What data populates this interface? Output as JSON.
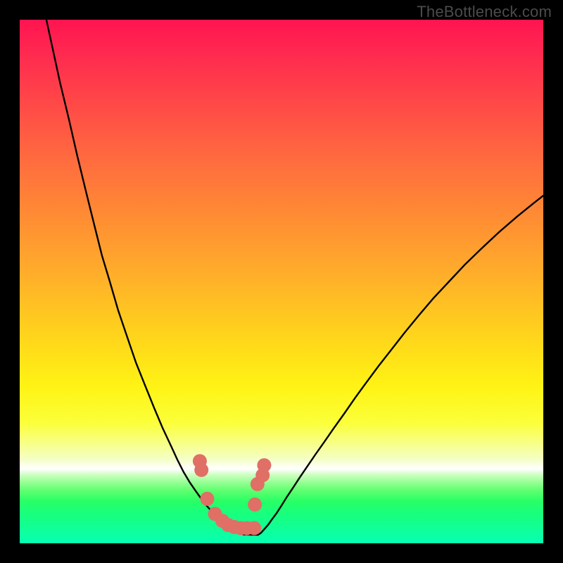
{
  "watermark": "TheBottleneck.com",
  "colors": {
    "frame": "#000000",
    "curve_stroke": "#000000",
    "marker_fill": "#e06f66",
    "marker_stroke": "#bd4e47"
  },
  "chart_data": {
    "type": "line",
    "title": "",
    "xlabel": "",
    "ylabel": "",
    "xlim": [
      0,
      100
    ],
    "ylim": [
      0,
      100
    ],
    "grid": false,
    "legend": false,
    "note": "Axes are unlabeled in the source image; x/y values are normalized 0–100 estimated from pixels. y is plotted with 0 at the bottom.",
    "series": [
      {
        "name": "curve",
        "type": "line",
        "x": [
          5.1,
          6.4,
          7.7,
          9.4,
          11.0,
          12.7,
          14.2,
          15.7,
          17.2,
          18.8,
          20.5,
          22.2,
          24.0,
          25.7,
          27.3,
          28.8,
          30.1,
          31.3,
          32.5,
          33.6,
          34.6,
          35.5,
          36.4,
          37.2,
          38.0,
          38.7,
          39.4,
          40.0,
          42.7,
          45.5,
          46.1,
          46.8,
          47.5,
          48.2,
          49.1,
          50.0,
          51.0,
          52.2,
          53.5,
          55.0,
          56.5,
          58.2,
          60.0,
          62.0,
          64.0,
          66.2,
          68.5,
          71.0,
          73.5,
          76.2,
          79.0,
          82.0,
          85.0,
          88.2,
          91.5,
          95.0,
          98.2,
          100.0
        ],
        "y": [
          100.0,
          94.0,
          88.0,
          81.0,
          74.0,
          67.0,
          61.0,
          55.0,
          50.0,
          44.5,
          39.5,
          34.5,
          30.0,
          25.8,
          22.0,
          18.8,
          16.0,
          13.6,
          11.6,
          10.0,
          8.6,
          7.4,
          6.4,
          5.6,
          4.9,
          4.3,
          3.7,
          3.2,
          1.7,
          1.6,
          2.0,
          2.8,
          3.6,
          4.6,
          5.8,
          7.2,
          8.8,
          10.6,
          12.6,
          14.8,
          17.0,
          19.4,
          22.0,
          24.8,
          27.7,
          30.7,
          33.8,
          37.0,
          40.2,
          43.5,
          46.8,
          50.0,
          53.2,
          56.3,
          59.4,
          62.4,
          65.0,
          66.4
        ]
      },
      {
        "name": "markers",
        "type": "scatter",
        "x": [
          34.4,
          34.7,
          35.8,
          37.3,
          38.7,
          39.8,
          41.0,
          42.2,
          43.4,
          44.8,
          44.9,
          45.4,
          46.4,
          46.7
        ],
        "y": [
          15.7,
          14.0,
          8.5,
          5.6,
          4.3,
          3.5,
          3.1,
          2.9,
          2.9,
          2.9,
          7.4,
          11.3,
          13.0,
          14.9
        ]
      }
    ]
  }
}
